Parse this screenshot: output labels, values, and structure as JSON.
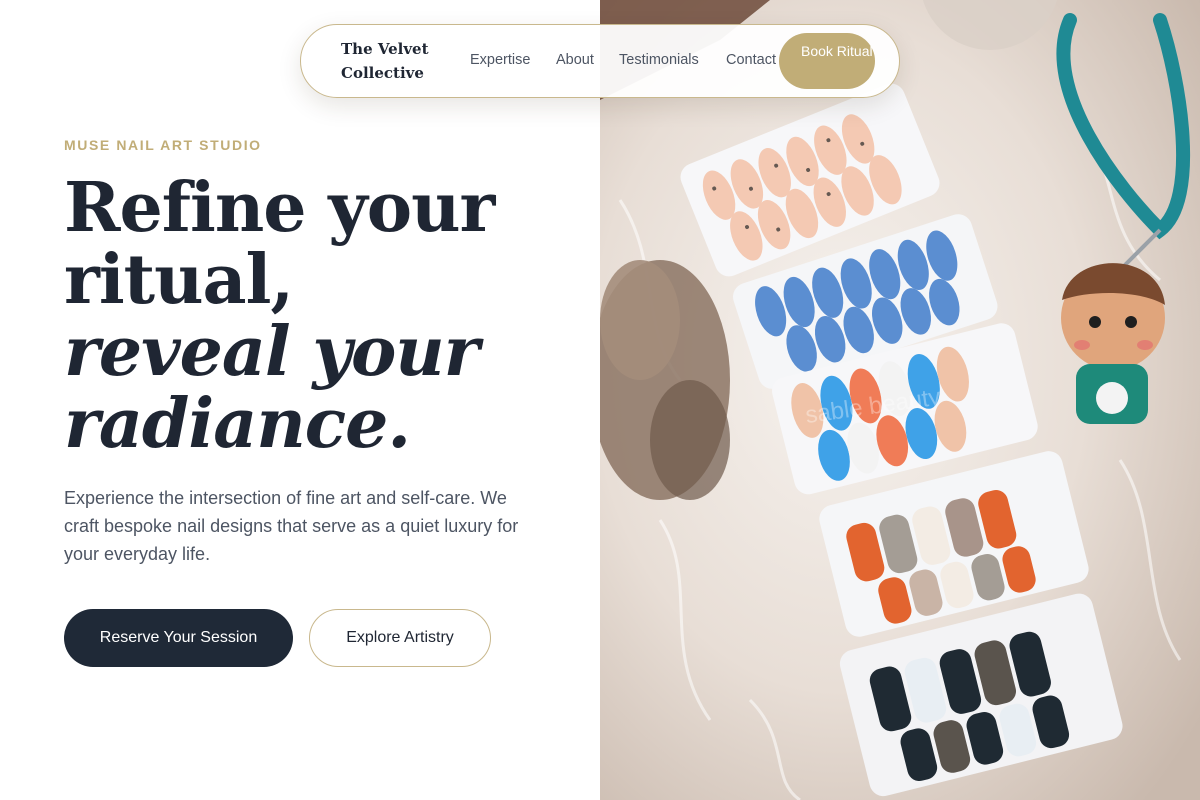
{
  "nav": {
    "brand": "The Velvet Collective",
    "links": [
      "Expertise",
      "About",
      "Testimonials",
      "Contact"
    ],
    "cta": "Book Ritual"
  },
  "hero": {
    "eyebrow": "MUSE NAIL ART STUDIO",
    "headline": {
      "line1": "Refine your",
      "line2": "ritual,",
      "line3": "reveal your",
      "line4": "radiance."
    },
    "description": "Experience the intersection of fine art and self-care. We craft bespoke nail designs that serve as a quiet luxury for your everyday life.",
    "primary_cta": "Reserve Your Session",
    "secondary_cta": "Explore Artistry"
  },
  "image": {
    "watermark": "sable beauty",
    "subject": "press-on nail sets displayed on cards over white fur with dried flowers and a keychain figure"
  },
  "colors": {
    "accent": "#c1ad77",
    "heading": "#1f2633",
    "body": "#4d5563",
    "button_dark": "#1f2937"
  }
}
